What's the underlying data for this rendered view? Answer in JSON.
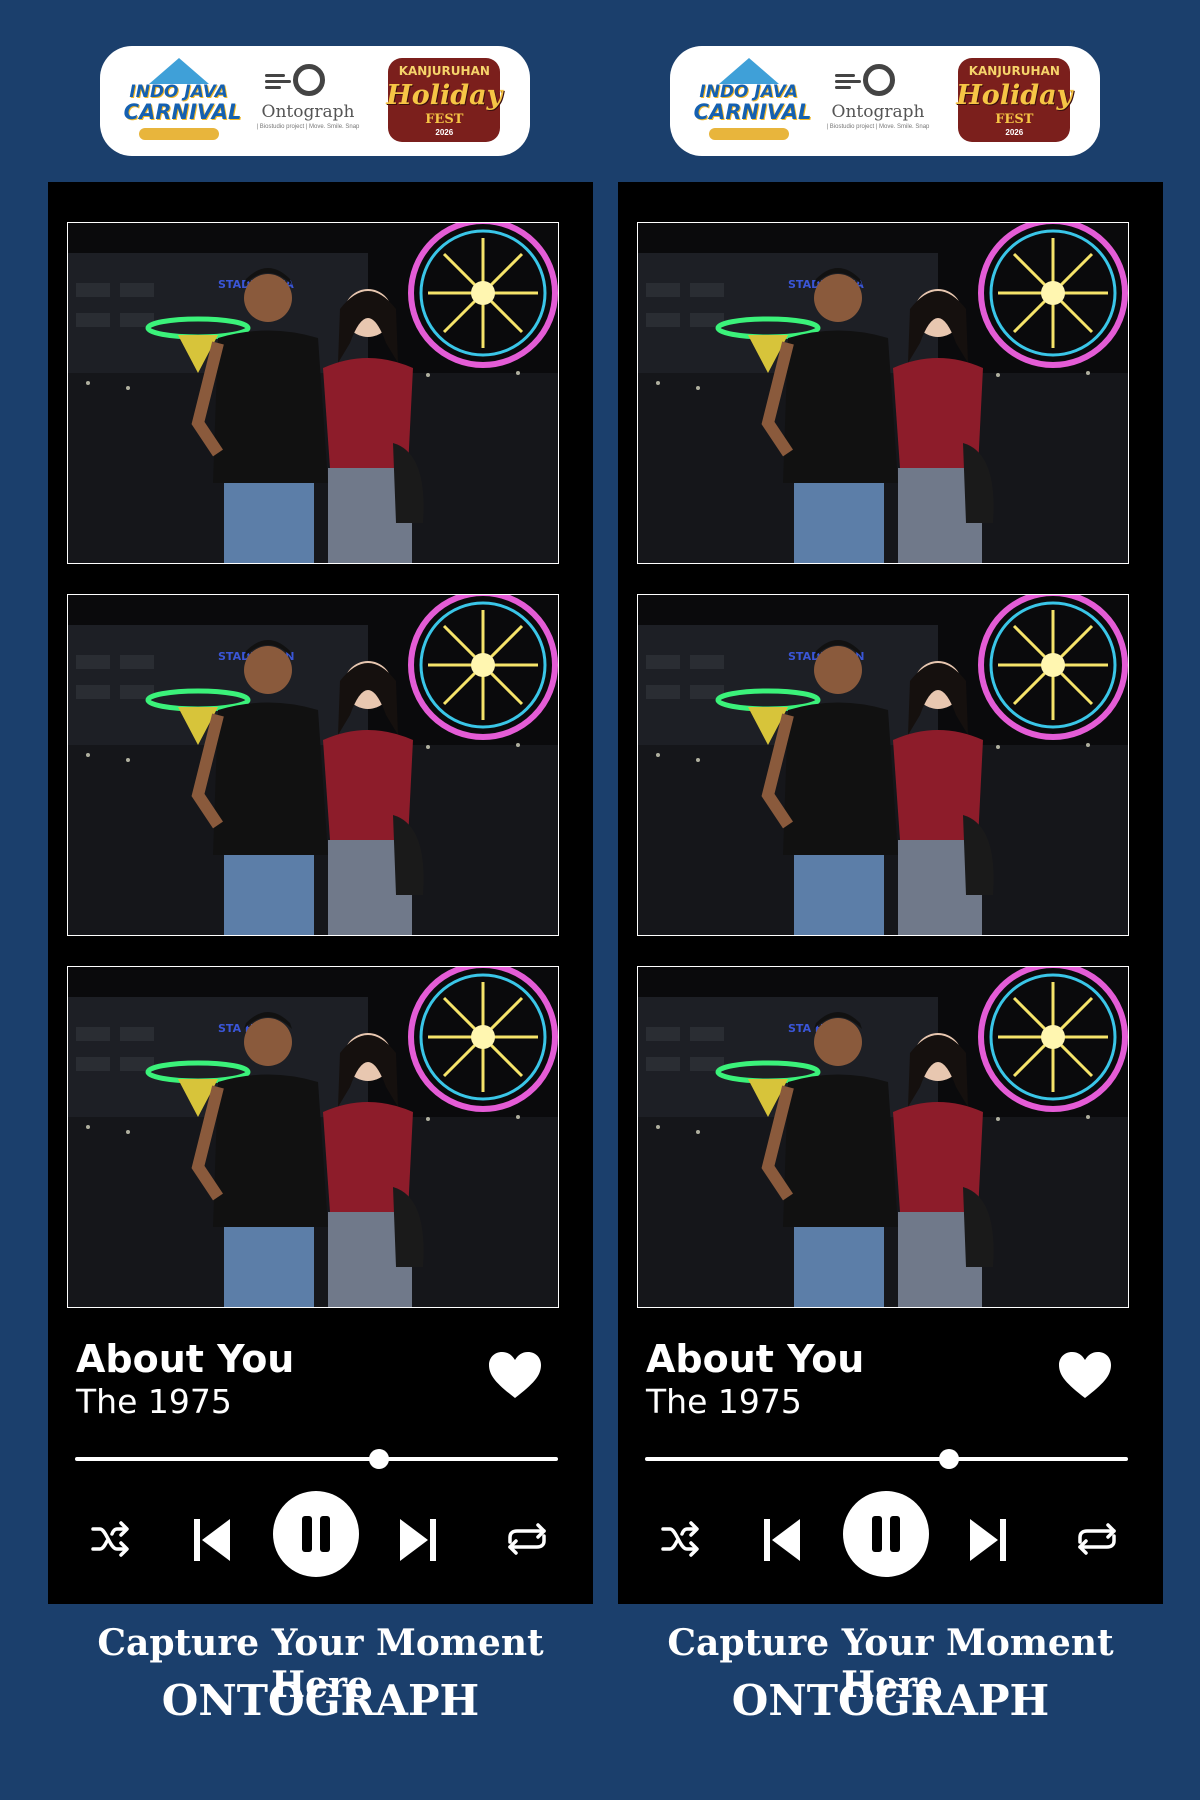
{
  "logos": {
    "carnival": {
      "line1": "INDO JAVA",
      "line2": "CARNIVAL"
    },
    "ontograph": {
      "name": "Ontograph",
      "tagline": "| Biostudio project |  Move. Smile. Snap"
    },
    "fest": {
      "top": "KANJURUHAN",
      "main": "Holiday",
      "sub": "FEST",
      "year": "2026"
    }
  },
  "photos": [
    {
      "sign_text": "STADION KA"
    },
    {
      "sign_text": "STADION      AN"
    },
    {
      "sign_text": "STA          HAN"
    }
  ],
  "player": {
    "song_title": "About You",
    "artist": "The 1975",
    "progress": 0.63
  },
  "icons": {
    "like": "heart-icon",
    "shuffle": "shuffle-icon",
    "previous": "skip-previous-icon",
    "pause": "pause-icon",
    "next": "skip-next-icon",
    "repeat": "repeat-icon"
  },
  "caption": {
    "line1": "Capture Your Moment Here",
    "line2": "ONTOGRAPH"
  },
  "colors": {
    "background": "#1b3f6c",
    "panel": "#000000",
    "accent": "#ffffff"
  }
}
